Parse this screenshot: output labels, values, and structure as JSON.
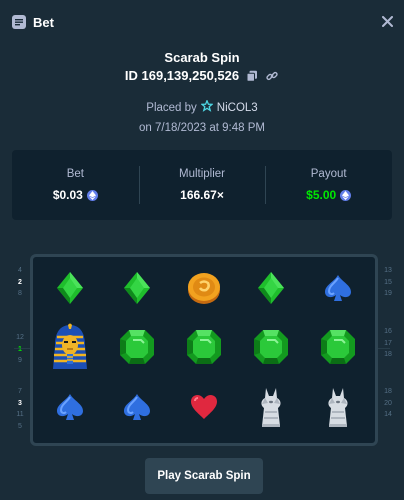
{
  "header": {
    "title": "Bet",
    "icon": "bet-slip-icon",
    "close_icon": "close-icon"
  },
  "game": {
    "name": "Scarab Spin",
    "bet_id": "ID 169,139,250,526"
  },
  "placed": {
    "by_label": "Placed by",
    "user": "NiCOL3",
    "user_badge": "vip-star-icon",
    "on_label": "on 7/18/2023 at 9:48 PM"
  },
  "stats": {
    "bet": {
      "label": "Bet",
      "value": "$0.03",
      "currency_icon": "ethereum-icon"
    },
    "multiplier": {
      "label": "Multiplier",
      "value": "166.67×"
    },
    "payout": {
      "label": "Payout",
      "value": "$5.00",
      "currency_icon": "ethereum-icon",
      "color": "#00e701"
    }
  },
  "reels": {
    "rows": [
      [
        "green-diamond-icon",
        "green-diamond-icon",
        "gold-coin-icon",
        "green-diamond-icon",
        "blue-spade-icon"
      ],
      [
        "pharaoh-icon",
        "green-emerald-icon",
        "green-emerald-icon",
        "green-emerald-icon",
        "green-emerald-icon"
      ],
      [
        "blue-spade-icon",
        "blue-spade-icon",
        "red-heart-icon",
        "anubis-statue-icon",
        "anubis-statue-icon"
      ]
    ]
  },
  "paylines_left": [
    [
      "4",
      "2",
      "8"
    ],
    [
      "12",
      "1",
      "9"
    ],
    [
      "7",
      "3",
      "11",
      "5"
    ]
  ],
  "paylines_right": [
    [
      "13",
      "15",
      "19"
    ],
    [
      "16",
      "17",
      "18"
    ],
    [
      "18",
      "20",
      "14"
    ]
  ],
  "play_button": {
    "label": "Play Scarab Spin"
  },
  "colors": {
    "background": "#1a2c38",
    "panel": "#0f212e",
    "border": "#2f4553",
    "muted": "#b1bad3",
    "win": "#00e701"
  }
}
